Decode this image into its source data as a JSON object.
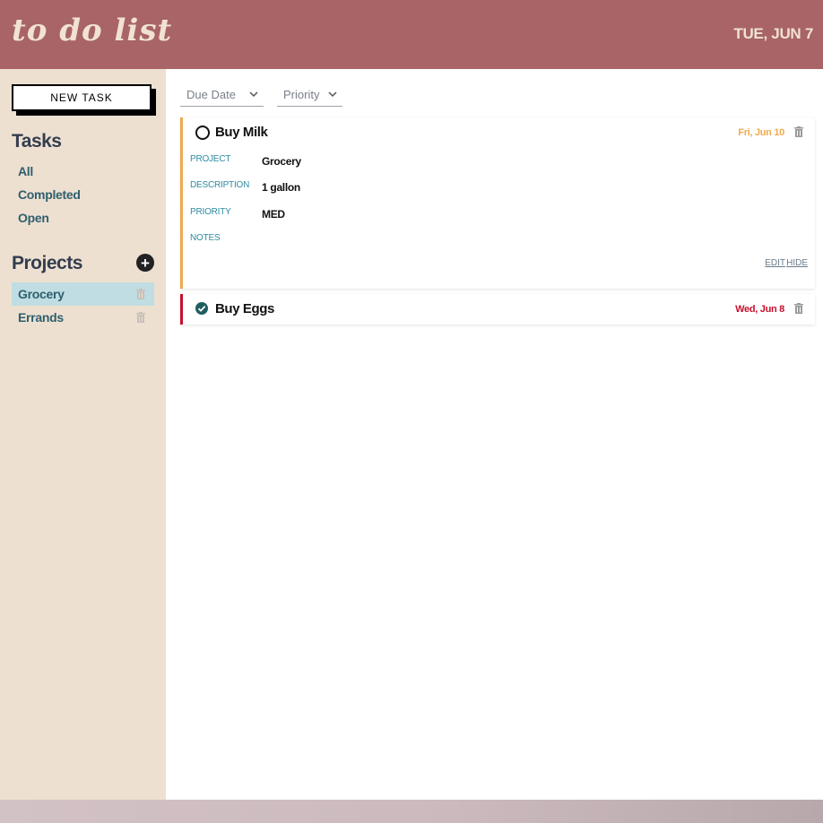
{
  "app": {
    "logo": "to do list",
    "today": "TUE, JUN 7"
  },
  "sidebar": {
    "new_task_label": "NEW TASK",
    "tasks_heading": "Tasks",
    "task_filters": [
      "All",
      "Completed",
      "Open"
    ],
    "projects_heading": "Projects",
    "add_project_symbol": "+",
    "projects": [
      {
        "name": "Grocery",
        "active": true
      },
      {
        "name": "Errands",
        "active": false
      }
    ]
  },
  "toolbar": {
    "sort_due_date": "Due Date",
    "sort_priority": "Priority"
  },
  "tasks": [
    {
      "title": "Buy Milk",
      "due": "Fri, Jun 10",
      "completed": false,
      "priority_color": "#efaa50",
      "expanded": true,
      "fields": [
        {
          "label": "PROJECT",
          "value": "Grocery"
        },
        {
          "label": "DESCRIPTION",
          "value": "1 gallon"
        },
        {
          "label": "PRIORITY",
          "value": "MED"
        },
        {
          "label": "NOTES",
          "value": ""
        }
      ],
      "edit_label": "EDIT",
      "hide_label": "HIDE"
    },
    {
      "title": "Buy Eggs",
      "due": "Wed, Jun 8",
      "completed": true,
      "priority_color": "#c8102e",
      "expanded": false
    }
  ],
  "colors": {
    "header": "#a86467",
    "sidebar": "#ede0d1",
    "accent_teal": "#2f5f6d",
    "due_orange": "#efaa50",
    "due_red": "#c8102e"
  }
}
